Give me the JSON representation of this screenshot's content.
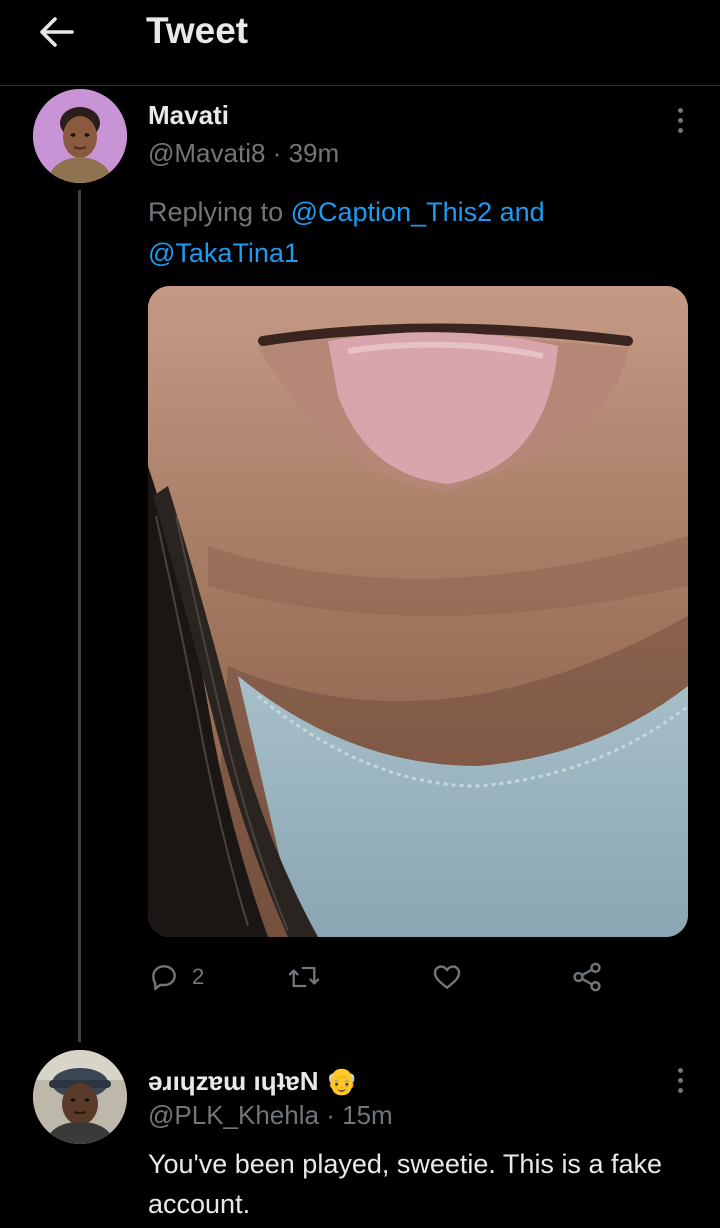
{
  "header": {
    "title": "Tweet",
    "back_icon": "arrow-left-icon"
  },
  "tweet": {
    "author_name": "Mavati",
    "author_handle": "@Mavati8",
    "separator": "·",
    "time": "39m",
    "replying_prefix": "Replying to",
    "mention_1": "@Caption_This2",
    "conjunction": "and",
    "mention_2": "@TakaTina1",
    "reply_count": "2",
    "icons": [
      "reply-icon",
      "retweet-icon",
      "like-icon",
      "share-icon"
    ]
  },
  "reply": {
    "author_name": "ǝɹıɥzɐɯ ıɥʇɐN",
    "author_emoji": "👴",
    "author_handle": "@PLK_Khehla",
    "separator": "·",
    "time": "15m",
    "text": "You've been played, sweetie. This is a fake account."
  },
  "colors": {
    "background": "#000000",
    "text": "#e7e9ea",
    "secondary": "#71767b",
    "link": "#1d9bf0",
    "divider": "#2f3336"
  }
}
